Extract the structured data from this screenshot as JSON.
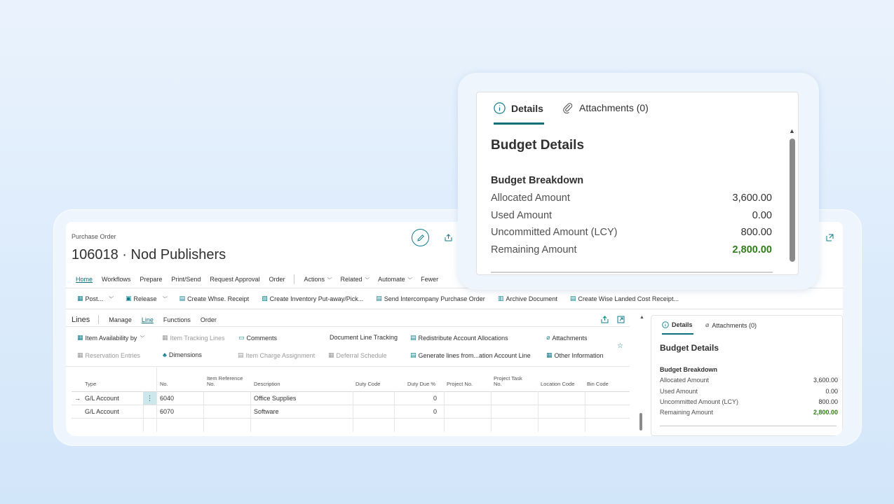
{
  "page": {
    "caption": "Purchase Order",
    "title": "106018 · Nod Publishers"
  },
  "nav": {
    "items": [
      "Home",
      "Workflows",
      "Prepare",
      "Print/Send",
      "Request Approval",
      "Order"
    ],
    "menus": [
      "Actions",
      "Related",
      "Automate"
    ],
    "fewer": "Fewer"
  },
  "actions": {
    "post": "Post...",
    "release": "Release",
    "create_whse_receipt": "Create Whse. Receipt",
    "create_inventory": "Create Inventory Put-away/Pick...",
    "send_intercompany": "Send Intercompany Purchase Order",
    "archive": "Archive Document",
    "create_wise": "Create Wise Landed Cost Receipt..."
  },
  "lines": {
    "title": "Lines",
    "tabs": [
      "Manage",
      "Line",
      "Functions",
      "Order"
    ],
    "toolbar_row1": {
      "item_availability": "Item Availability by",
      "item_tracking": "Item Tracking Lines",
      "comments": "Comments",
      "doc_line_tracking": "Document Line Tracking",
      "redistribute": "Redistribute Account Allocations",
      "attachments": "Attachments"
    },
    "toolbar_row2": {
      "reservation": "Reservation Entries",
      "dimensions": "Dimensions",
      "item_charge": "Item Charge Assignment",
      "deferral": "Deferral Schedule",
      "generate": "Generate lines from...ation Account Line",
      "other_info": "Other Information"
    },
    "columns": {
      "type": "Type",
      "no": "No.",
      "item_ref_1": "Item Reference",
      "item_ref_2": "No.",
      "description": "Description",
      "duty_code": "Duty Code",
      "duty_due": "Duty Due %",
      "project_no": "Project No.",
      "project_task_1": "Project Task",
      "project_task_2": "No.",
      "location_code": "Location Code",
      "bin_code": "Bin Code"
    },
    "rows": [
      {
        "type": "G/L Account",
        "no": "6040",
        "description": "Office Supplies",
        "duty_due": "0"
      },
      {
        "type": "G/L Account",
        "no": "6070",
        "description": "Software",
        "duty_due": "0"
      }
    ]
  },
  "factbox": {
    "tab_details": "Details",
    "tab_attachments": "Attachments (0)",
    "heading": "Budget Details",
    "section": "Budget Breakdown",
    "rows": [
      {
        "label": "Allocated Amount",
        "value": "3,600.00"
      },
      {
        "label": "Used Amount",
        "value": "0.00"
      },
      {
        "label": "Uncommitted Amount (LCY)",
        "value": "800.00"
      },
      {
        "label": "Remaining Amount",
        "value": "2,800.00"
      }
    ]
  },
  "colors": {
    "accent": "#0f7b8a",
    "positive": "#2e7d18"
  }
}
